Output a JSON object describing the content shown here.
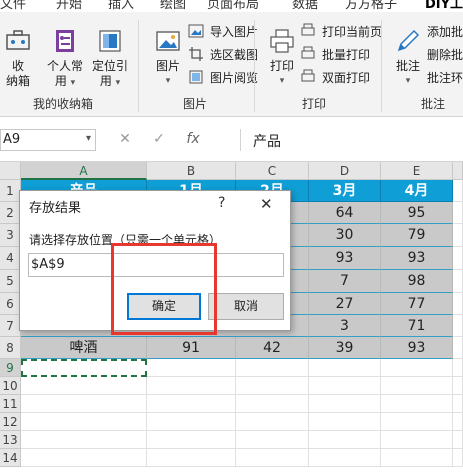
{
  "tabs": [
    "文件",
    "开始",
    "插入",
    "绘图",
    "页面布局",
    "数据",
    "方方格子",
    "DIY工具箱"
  ],
  "ribbon": {
    "collect_label_1": "收",
    "collect_label_2": "纳箱",
    "personal_label_1": "个人常",
    "personal_label_2": "用",
    "locate_label_1": "定位引",
    "locate_label_2": "用",
    "group_collect": "我的收纳箱",
    "image_label": "图片",
    "import_image": "导入图片",
    "crop_region": "选区截图",
    "image_view": "图片阅览",
    "group_image": "图片",
    "print_label": "打印",
    "print_current": "打印当前页",
    "batch_print": "批量打印",
    "duplex_print": "双面打印",
    "group_print": "打印",
    "comment_label": "批注",
    "add_comment": "添加批",
    "delete_comment": "删除批",
    "comment_format": "批注环",
    "group_comment": "批注"
  },
  "formula_bar": {
    "name_box": "A9",
    "cancel_glyph": "✕",
    "confirm_glyph": "✓",
    "fx_glyph": "fx",
    "content": "产品"
  },
  "columns": [
    "A",
    "B",
    "C",
    "D",
    "E"
  ],
  "rows": [
    "1",
    "2",
    "3",
    "4",
    "5",
    "6",
    "7",
    "8",
    "9",
    "10",
    "11",
    "12",
    "13",
    "14"
  ],
  "header_row": [
    "产品",
    "1月",
    "2月",
    "3月",
    "4月"
  ],
  "visible_values": {
    "r2": [
      "64",
      "95"
    ],
    "r3": [
      "30",
      "79"
    ],
    "r4": [
      "93",
      "93"
    ],
    "r5": [
      "7",
      "98"
    ],
    "r6": [
      "27",
      "77"
    ],
    "r7": [
      "3",
      "71"
    ],
    "r8": [
      "啤酒",
      "91",
      "42",
      "39",
      "93"
    ]
  },
  "dialog": {
    "title": "存放结果",
    "help": "?",
    "close": "✕",
    "prompt": "请选择存放位置（只需一个单元格）",
    "value": "$A$9",
    "ok": "确定",
    "cancel": "取消"
  }
}
